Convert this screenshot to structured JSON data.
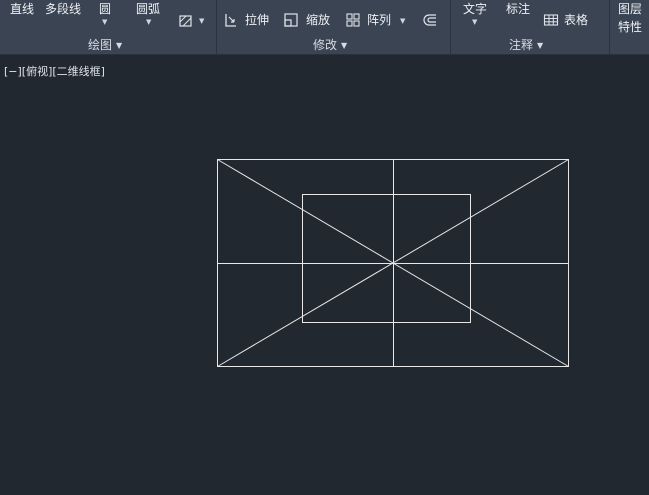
{
  "ribbon": {
    "draw": {
      "line": "直线",
      "polyline": "多段线",
      "circle": "圆",
      "arc": "圆弧",
      "label": "绘图"
    },
    "modify": {
      "stretch": "拉伸",
      "scale": "缩放",
      "array": "阵列",
      "label": "修改"
    },
    "annotation": {
      "text": "文字",
      "dimension": "标注",
      "table": "表格",
      "label": "注释"
    },
    "layers": {
      "layer": "图层",
      "properties": "特性"
    }
  },
  "viewport": {
    "view_controls": "[−][俯视][二维线框]"
  },
  "colors": {
    "background": "#212830",
    "ribbon": "#3b4453",
    "linework": "#e8e8e8"
  }
}
